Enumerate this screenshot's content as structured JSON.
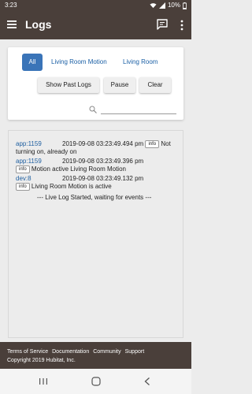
{
  "status_bar": {
    "time": "3:23",
    "battery": "10%"
  },
  "app_bar": {
    "title": "Logs"
  },
  "tabs": [
    {
      "label": "All"
    },
    {
      "label": "Living Room Motion"
    },
    {
      "label": "Living Room"
    }
  ],
  "buttons": {
    "show_past_logs": "Show Past Logs",
    "pause": "Pause",
    "clear": "Clear"
  },
  "logs": [
    {
      "source": "app:1159",
      "timestamp": "2019-09-08 03:23:49.494 pm",
      "level": "info",
      "message_inline": "Not",
      "message_rest": "turning on, already on"
    },
    {
      "source": "app:1159",
      "timestamp": "2019-09-08 03:23:49.396 pm",
      "level": "info",
      "message": "Motion active Living Room Motion"
    },
    {
      "source": "dev:8",
      "timestamp": "2019-09-08 03:23:49.132 pm",
      "level": "info",
      "message": "Living Room Motion is active"
    }
  ],
  "live_log_message": "--- Live Log Started, waiting for events ---",
  "footer": {
    "links": [
      "Terms of Service",
      "Documentation",
      "Community",
      "Support"
    ],
    "copyright": "Copyright 2019 Hubitat, Inc."
  },
  "colors": {
    "app_bar": "#4a3f3a",
    "active_tab": "#3a74b8",
    "link": "#1a5fa5"
  }
}
